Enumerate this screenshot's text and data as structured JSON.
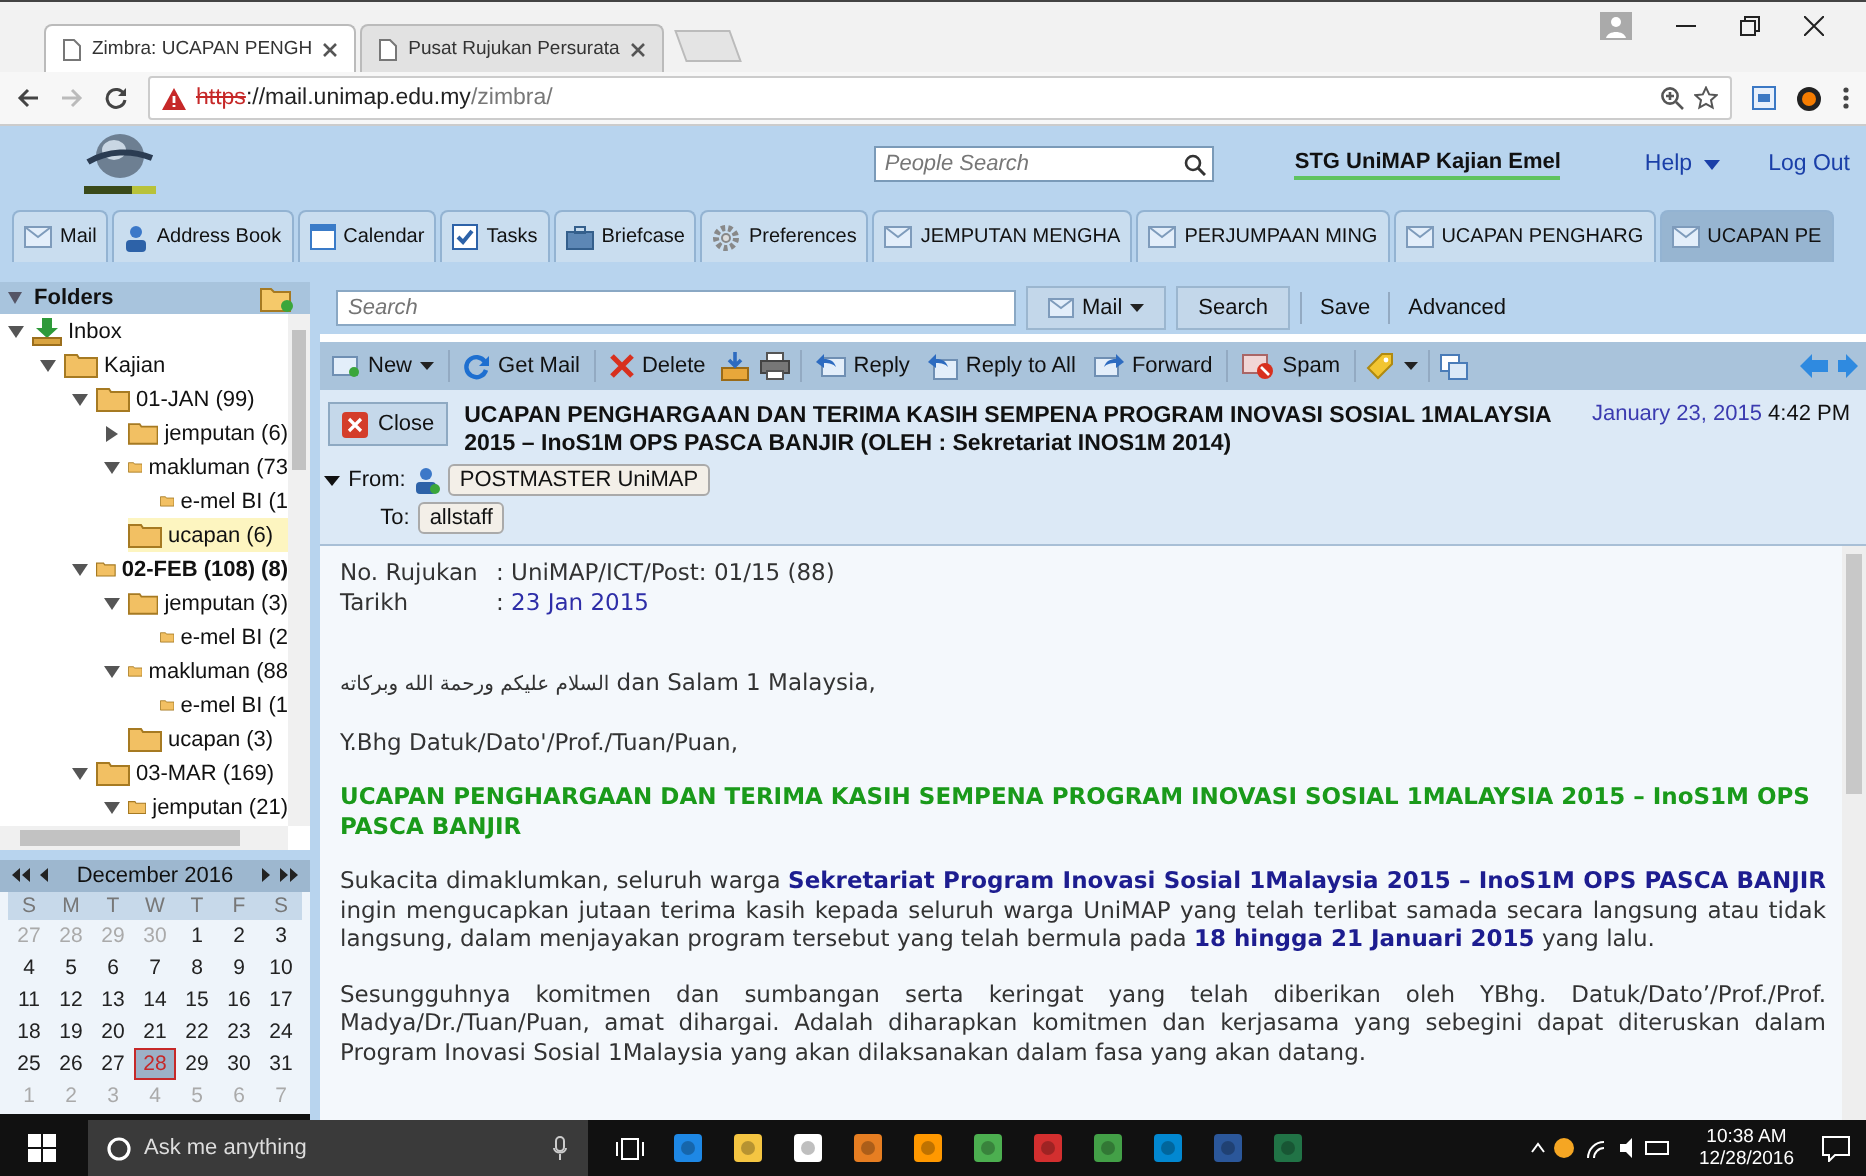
{
  "browser": {
    "tabs": [
      {
        "title": "Zimbra: UCAPAN PENGH",
        "selected": true
      },
      {
        "title": "Pusat Rujukan Persurata",
        "selected": false
      }
    ],
    "url": {
      "insecure": true,
      "scheme": "https",
      "host": "://mail.unimap.edu.my",
      "path": "/zimbra/"
    }
  },
  "header": {
    "people_search": {
      "placeholder": "People Search"
    },
    "user": "STG UniMAP Kajian Emel",
    "help": "Help",
    "logout": "Log Out"
  },
  "app_tabs": [
    {
      "label": "Mail",
      "kind": "mail",
      "selected": false
    },
    {
      "label": "Address Book",
      "kind": "contacts",
      "selected": false
    },
    {
      "label": "Calendar",
      "kind": "calendar",
      "selected": false
    },
    {
      "label": "Tasks",
      "kind": "tasks",
      "selected": false
    },
    {
      "label": "Briefcase",
      "kind": "briefcase",
      "selected": false
    },
    {
      "label": "Preferences",
      "kind": "preferences",
      "selected": false
    },
    {
      "label": "JEMPUTAN MENGHA",
      "kind": "message",
      "selected": false
    },
    {
      "label": "PERJUMPAAN MING",
      "kind": "message",
      "selected": false
    },
    {
      "label": "UCAPAN PENGHARG",
      "kind": "message",
      "selected": false
    },
    {
      "label": "UCAPAN PE",
      "kind": "message",
      "selected": true
    }
  ],
  "search": {
    "placeholder": "Search",
    "scope": "Mail",
    "search": "Search",
    "save": "Save",
    "advanced": "Advanced"
  },
  "toolbar": {
    "new": "New",
    "get_mail": "Get Mail",
    "delete": "Delete",
    "reply": "Reply",
    "reply_all": "Reply to All",
    "forward": "Forward",
    "spam": "Spam"
  },
  "folders": {
    "title": "Folders",
    "tree": [
      {
        "label": "Inbox",
        "kind": "inbox",
        "expanded": true,
        "selected": false,
        "unread": false,
        "children": [
          {
            "label": "Kajian",
            "kind": "folder",
            "expanded": true,
            "selected": false,
            "unread": false,
            "children": [
              {
                "label": "01-JAN (99)",
                "kind": "folder",
                "expanded": true,
                "selected": false,
                "unread": false,
                "children": [
                  {
                    "label": "jemputan (6)",
                    "kind": "folder",
                    "expanded": false,
                    "selected": false,
                    "unread": false
                  },
                  {
                    "label": "makluman (73",
                    "kind": "folder",
                    "expanded": true,
                    "selected": false,
                    "unread": false,
                    "children": [
                      {
                        "label": "e-mel BI (1",
                        "kind": "folder",
                        "selected": false,
                        "unread": false
                      }
                    ]
                  },
                  {
                    "label": "ucapan (6)",
                    "kind": "folder",
                    "selected": true,
                    "unread": false
                  }
                ]
              },
              {
                "label": "02-FEB (108) (8)",
                "kind": "folder",
                "expanded": true,
                "selected": false,
                "unread": true,
                "children": [
                  {
                    "label": "jemputan (3)",
                    "kind": "folder",
                    "expanded": true,
                    "selected": false,
                    "unread": false,
                    "children": [
                      {
                        "label": "e-mel BI (2",
                        "kind": "folder",
                        "selected": false,
                        "unread": false
                      }
                    ]
                  },
                  {
                    "label": "makluman (88",
                    "kind": "folder",
                    "expanded": true,
                    "selected": false,
                    "unread": false,
                    "children": [
                      {
                        "label": "e-mel BI (1",
                        "kind": "folder",
                        "selected": false,
                        "unread": false
                      }
                    ]
                  },
                  {
                    "label": "ucapan (3)",
                    "kind": "folder",
                    "selected": false,
                    "unread": false
                  }
                ]
              },
              {
                "label": "03-MAR (169)",
                "kind": "folder",
                "expanded": true,
                "selected": false,
                "unread": false,
                "children": [
                  {
                    "label": "jemputan (21)",
                    "kind": "folder",
                    "expanded": true,
                    "selected": false,
                    "unread": false
                  }
                ]
              }
            ]
          }
        ]
      }
    ]
  },
  "calendar": {
    "title": "December 2016",
    "weekdays": [
      "S",
      "M",
      "T",
      "W",
      "T",
      "F",
      "S"
    ],
    "weeks": [
      [
        {
          "day": "27",
          "other_month": true,
          "selected": false
        },
        {
          "day": "28",
          "other_month": true,
          "selected": false
        },
        {
          "day": "29",
          "other_month": true,
          "selected": false
        },
        {
          "day": "30",
          "other_month": true,
          "selected": false
        },
        {
          "day": "1",
          "other_month": false,
          "selected": false
        },
        {
          "day": "2",
          "other_month": false,
          "selected": false
        },
        {
          "day": "3",
          "other_month": false,
          "selected": false
        }
      ],
      [
        {
          "day": "4",
          "other_month": false,
          "selected": false
        },
        {
          "day": "5",
          "other_month": false,
          "selected": false
        },
        {
          "day": "6",
          "other_month": false,
          "selected": false
        },
        {
          "day": "7",
          "other_month": false,
          "selected": false
        },
        {
          "day": "8",
          "other_month": false,
          "selected": false
        },
        {
          "day": "9",
          "other_month": false,
          "selected": false
        },
        {
          "day": "10",
          "other_month": false,
          "selected": false
        }
      ],
      [
        {
          "day": "11",
          "other_month": false,
          "selected": false
        },
        {
          "day": "12",
          "other_month": false,
          "selected": false
        },
        {
          "day": "13",
          "other_month": false,
          "selected": false
        },
        {
          "day": "14",
          "other_month": false,
          "selected": false
        },
        {
          "day": "15",
          "other_month": false,
          "selected": false
        },
        {
          "day": "16",
          "other_month": false,
          "selected": false
        },
        {
          "day": "17",
          "other_month": false,
          "selected": false
        }
      ],
      [
        {
          "day": "18",
          "other_month": false,
          "selected": false
        },
        {
          "day": "19",
          "other_month": false,
          "selected": false
        },
        {
          "day": "20",
          "other_month": false,
          "selected": false
        },
        {
          "day": "21",
          "other_month": false,
          "selected": false
        },
        {
          "day": "22",
          "other_month": false,
          "selected": false
        },
        {
          "day": "23",
          "other_month": false,
          "selected": false
        },
        {
          "day": "24",
          "other_month": false,
          "selected": false
        }
      ],
      [
        {
          "day": "25",
          "other_month": false,
          "selected": false
        },
        {
          "day": "26",
          "other_month": false,
          "selected": false
        },
        {
          "day": "27",
          "other_month": false,
          "selected": false
        },
        {
          "day": "28",
          "other_month": false,
          "selected": true
        },
        {
          "day": "29",
          "other_month": false,
          "selected": false
        },
        {
          "day": "30",
          "other_month": false,
          "selected": false
        },
        {
          "day": "31",
          "other_month": false,
          "selected": false
        }
      ],
      [
        {
          "day": "1",
          "other_month": true,
          "selected": false
        },
        {
          "day": "2",
          "other_month": true,
          "selected": false
        },
        {
          "day": "3",
          "other_month": true,
          "selected": false
        },
        {
          "day": "4",
          "other_month": true,
          "selected": false
        },
        {
          "day": "5",
          "other_month": true,
          "selected": false
        },
        {
          "day": "6",
          "other_month": true,
          "selected": false
        },
        {
          "day": "7",
          "other_month": true,
          "selected": false
        }
      ]
    ]
  },
  "message": {
    "close": "Close",
    "subject": "UCAPAN PENGHARGAAN DAN TERIMA KASIH SEMPENA PROGRAM INOVASI SOSIAL 1MALAYSIA 2015 – InoS1M OPS PASCA BANJIR (OLEH : Sekretariat INOS1M 2014)",
    "date": "January 23, 2015",
    "time": "4:42 PM",
    "from_label": "From:",
    "from": "POSTMASTER UniMAP",
    "to_label": "To:",
    "to": "allstaff",
    "refs": [
      {
        "label": "No. Rujukan",
        "separator": ":",
        "value": "UniMAP/ICT/Post: 01/15 (88)",
        "kind": "text"
      },
      {
        "label": "Tarikh",
        "separator": ":",
        "value": "23 Jan 2015",
        "kind": "date"
      }
    ],
    "paragraphs": [
      {
        "kind": "greeting",
        "arabic": "السلام عليكم ورحمة الله وبركاته",
        "text": "dan Salam 1 Malaysia,"
      },
      {
        "kind": "text",
        "text": "Y.Bhg Datuk/Dato'/Prof./Tuan/Puan,"
      },
      {
        "kind": "heading",
        "text": "UCAPAN PENGHARGAAN DAN TERIMA KASIH SEMPENA PROGRAM INOVASI SOSIAL 1MALAYSIA 2015 – InoS1M OPS PASCA BANJIR"
      },
      {
        "kind": "justified",
        "text": "Sukacita dimaklumkan, seluruh warga **Sekretariat Program Inovasi Sosial 1Malaysia 2015 – InoS1M OPS PASCA BANJIR** ingin mengucapkan jutaan terima kasih kepada seluruh warga UniMAP yang telah terlibat samada secara langsung atau tidak langsung, dalam menjayakan program tersebut yang telah bermula pada **18 hingga 21 Januari 2015** yang lalu."
      },
      {
        "kind": "justified",
        "text": "Sesungguhnya komitmen dan sumbangan serta keringat yang telah diberikan oleh YBhg. Datuk/Dato’/Prof./Prof. Madya/Dr./Tuan/Puan, amat dihargai. Adalah diharapkan komitmen dan kerjasama yang sebegini dapat diteruskan dalam Program Inovasi Sosial 1Malaysia yang akan dilaksanakan dalam fasa yang akan datang."
      }
    ]
  },
  "taskbar": {
    "search_placeholder": "Ask me anything",
    "time": "10:38 AM",
    "date": "12/28/2016"
  }
}
